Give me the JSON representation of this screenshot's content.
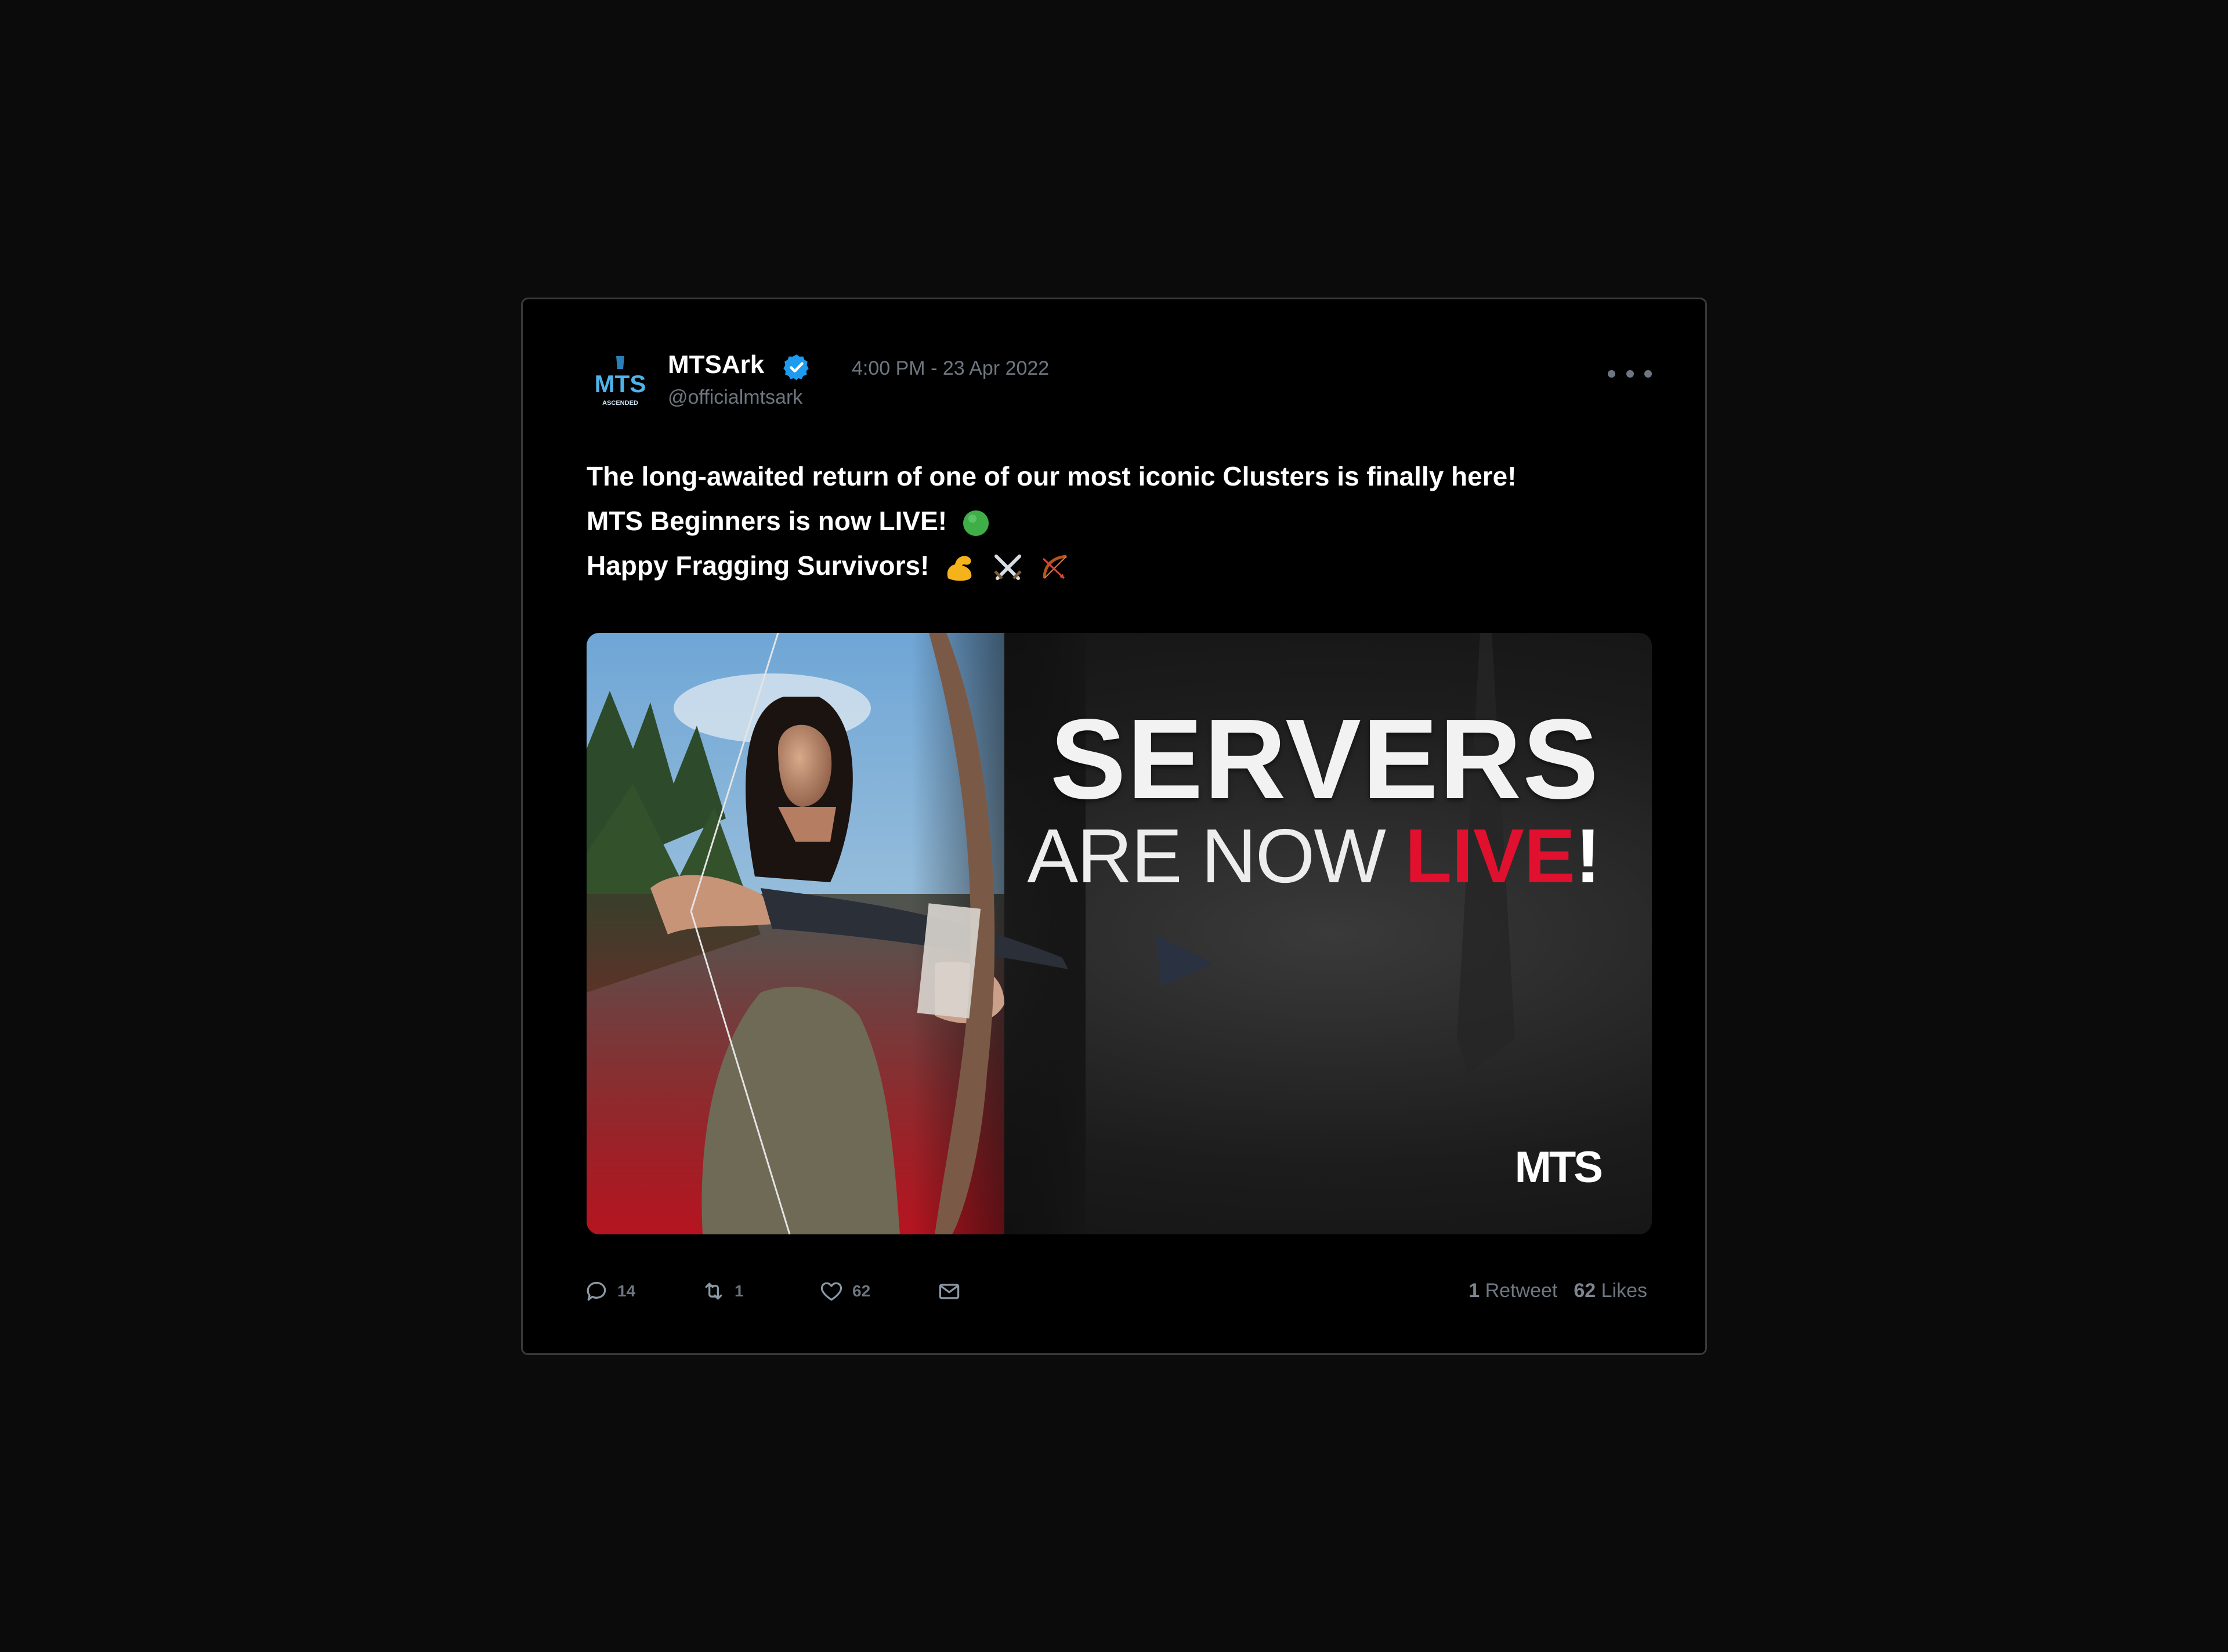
{
  "tweet": {
    "author_name": "MTSArk",
    "handle": "@officialmtsark",
    "timestamp": "4:00 PM - 23 Apr 2022",
    "avatar_text": "MTS",
    "avatar_subtext": "ASCENDED",
    "lines": [
      "The long-awaited return of one of our most iconic Clusters is finally here!",
      "MTS Beginners is now LIVE!",
      "Happy Fragging Survivors!"
    ],
    "emojis": [
      "green-circle",
      "flexed-biceps",
      "crossed-swords",
      "bow-and-arrow"
    ]
  },
  "media": {
    "headline_big": "SERVERS",
    "headline_small": "ARE NOW ",
    "headline_highlight": "LIVE",
    "headline_bang": "!",
    "brand": "MTS",
    "highlight_color": "#e0102e"
  },
  "actions": {
    "replies": "14",
    "retweets": "1",
    "likes": "62"
  },
  "stats": {
    "retweet_count": "1",
    "retweet_label": "Retweet",
    "like_count": "62",
    "like_label": "Likes"
  }
}
